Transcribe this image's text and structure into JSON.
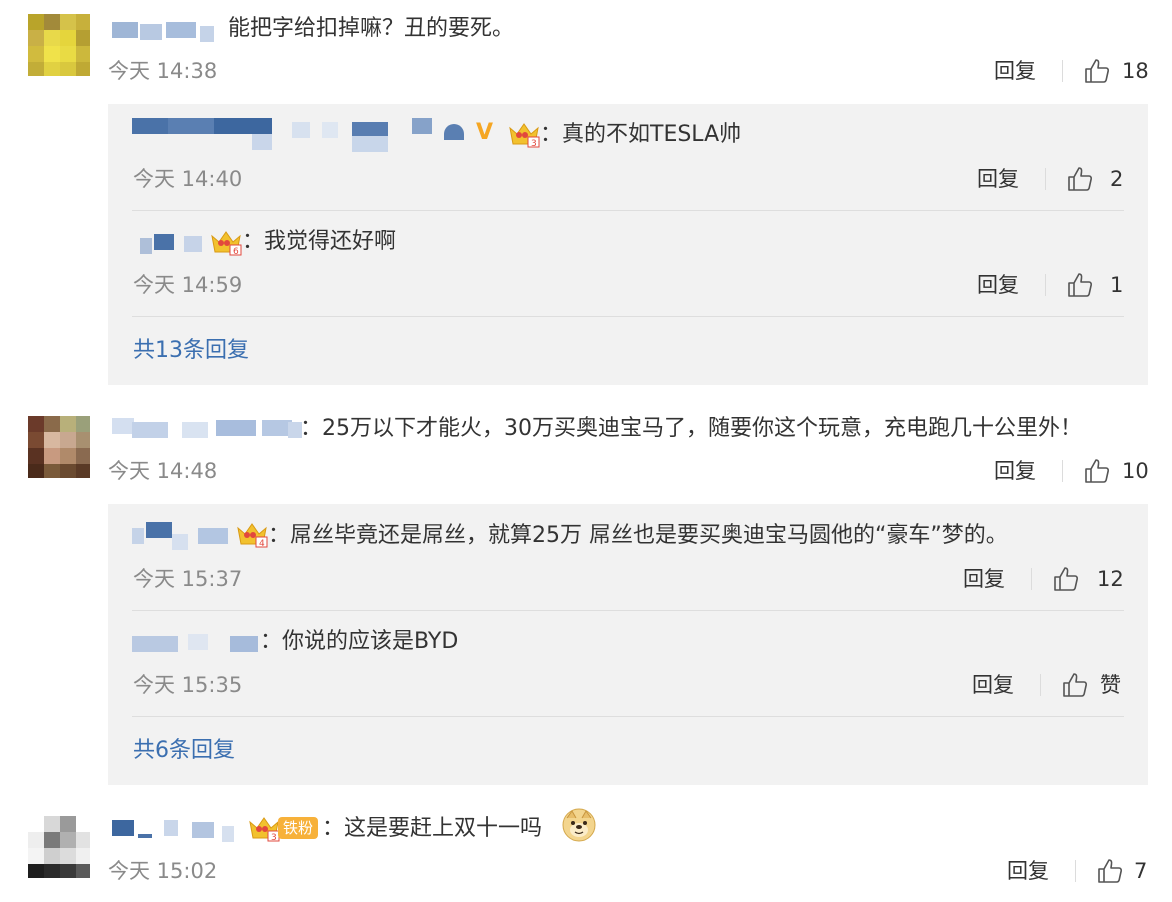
{
  "comments": [
    {
      "text": "能把字给扣掉嘛？丑的要死。",
      "time": "今天 14:38",
      "reply_label": "回复",
      "likes": "18",
      "replies": [
        {
          "text": "：真的不如TESLA帅",
          "time": "今天 14:40",
          "reply_label": "回复",
          "likes": "2"
        },
        {
          "text": "：我觉得还好啊",
          "time": "今天 14:59",
          "reply_label": "回复",
          "likes": "1"
        }
      ],
      "more_replies": "共13条回复"
    },
    {
      "text": "：25万以下才能火，30万买奥迪宝马了，随要你这个玩意，充电跑几十公里外！",
      "time": "今天 14:48",
      "reply_label": "回复",
      "likes": "10",
      "replies": [
        {
          "text": "：屌丝毕竟还是屌丝，就算25万 屌丝也是要买奥迪宝马圆他的“豪车”梦的。",
          "time": "今天 15:37",
          "reply_label": "回复",
          "likes": "12"
        },
        {
          "text": "：你说的应该是BYD",
          "time": "今天 15:35",
          "reply_label": "回复",
          "likes": "赞"
        }
      ],
      "more_replies": "共6条回复"
    },
    {
      "text": "：这是要赶上双十一吗",
      "time": "今天 15:02",
      "reply_label": "回复",
      "likes": "7",
      "badge": "铁粉"
    }
  ],
  "colors": {
    "link": "#3b6fb0",
    "time": "#8a8a8a",
    "reply_bg": "#f2f2f2",
    "badge": "#f7b13a"
  }
}
